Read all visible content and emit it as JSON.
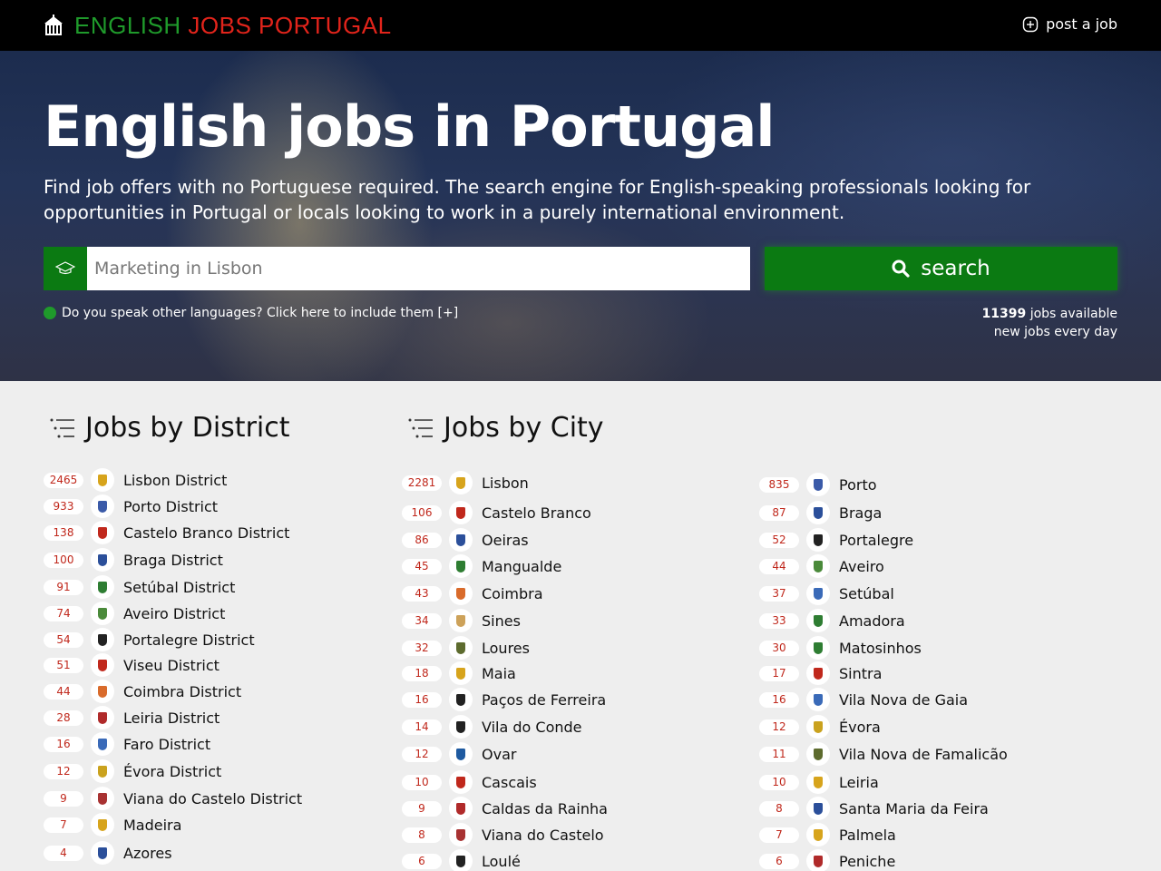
{
  "brand": {
    "part1": "ENGLISH",
    "part2": "JOBS PORTUGAL"
  },
  "nav": {
    "post_job": "post a job"
  },
  "hero": {
    "title": "English jobs in Portugal",
    "subtitle": "Find job offers with no Portuguese required. The search engine for English-speaking professionals looking for opportunities in Portugal or locals looking to work in a purely international environment."
  },
  "search": {
    "placeholder": "Marketing in Lisbon",
    "value": "",
    "button": "search"
  },
  "languages_link": "Do you speak other languages? Click here to include them [+]",
  "stats": {
    "count": "11399",
    "available": " jobs available",
    "new_jobs": "new jobs every day"
  },
  "districts": {
    "heading": "Jobs by District",
    "items": [
      {
        "count": "2465",
        "name": "Lisbon District",
        "color": "#d7a41c"
      },
      {
        "count": "933",
        "name": "Porto District",
        "color": "#3a5aa8"
      },
      {
        "count": "138",
        "name": "Castelo Branco District",
        "color": "#c0281c"
      },
      {
        "count": "100",
        "name": "Braga District",
        "color": "#2b4f9a"
      },
      {
        "count": "91",
        "name": "Setúbal District",
        "color": "#2e7d32"
      },
      {
        "count": "74",
        "name": "Aveiro District",
        "color": "#4a8a3a"
      },
      {
        "count": "54",
        "name": "Portalegre District",
        "color": "#222222"
      },
      {
        "count": "51",
        "name": "Viseu District",
        "color": "#c0281c"
      },
      {
        "count": "44",
        "name": "Coimbra District",
        "color": "#d96b2b"
      },
      {
        "count": "28",
        "name": "Leiria District",
        "color": "#b02a2a"
      },
      {
        "count": "16",
        "name": "Faro District",
        "color": "#3a6ab8"
      },
      {
        "count": "12",
        "name": "Évora District",
        "color": "#caa21e"
      },
      {
        "count": "9",
        "name": "Viana do Castelo District",
        "color": "#a83232"
      },
      {
        "count": "7",
        "name": "Madeira",
        "color": "#d7a41c"
      },
      {
        "count": "4",
        "name": "Azores",
        "color": "#2b4f9a"
      }
    ]
  },
  "cities": {
    "heading": "Jobs by City",
    "col1": [
      {
        "count": "2281",
        "name": "Lisbon",
        "color": "#d7a41c"
      },
      {
        "count": "106",
        "name": "Castelo Branco",
        "color": "#c0281c"
      },
      {
        "count": "86",
        "name": "Oeiras",
        "color": "#2b4f9a"
      },
      {
        "count": "45",
        "name": "Mangualde",
        "color": "#2e7d32"
      },
      {
        "count": "43",
        "name": "Coimbra",
        "color": "#d96b2b"
      },
      {
        "count": "34",
        "name": "Sines",
        "color": "#cda25a"
      },
      {
        "count": "32",
        "name": "Loures",
        "color": "#5d6b2e"
      },
      {
        "count": "18",
        "name": "Maia",
        "color": "#d7a41c"
      },
      {
        "count": "16",
        "name": "Paços de Ferreira",
        "color": "#222222"
      },
      {
        "count": "14",
        "name": "Vila do Conde",
        "color": "#222222"
      },
      {
        "count": "12",
        "name": "Ovar",
        "color": "#1e5aa0"
      },
      {
        "count": "10",
        "name": "Cascais",
        "color": "#c0281c"
      },
      {
        "count": "9",
        "name": "Caldas da Rainha",
        "color": "#b02a2a"
      },
      {
        "count": "8",
        "name": "Viana do Castelo",
        "color": "#a83232"
      },
      {
        "count": "6",
        "name": "Loulé",
        "color": "#222222"
      }
    ],
    "col2": [
      {
        "count": "835",
        "name": "Porto",
        "color": "#3a5aa8"
      },
      {
        "count": "87",
        "name": "Braga",
        "color": "#2b4f9a"
      },
      {
        "count": "52",
        "name": "Portalegre",
        "color": "#222222"
      },
      {
        "count": "44",
        "name": "Aveiro",
        "color": "#4a8a3a"
      },
      {
        "count": "37",
        "name": "Setúbal",
        "color": "#3a6ab8"
      },
      {
        "count": "33",
        "name": "Amadora",
        "color": "#2e7d32"
      },
      {
        "count": "30",
        "name": "Matosinhos",
        "color": "#2e7d32"
      },
      {
        "count": "17",
        "name": "Sintra",
        "color": "#c0281c"
      },
      {
        "count": "16",
        "name": "Vila Nova de Gaia",
        "color": "#3a6ab8"
      },
      {
        "count": "12",
        "name": "Évora",
        "color": "#caa21e"
      },
      {
        "count": "11",
        "name": "Vila Nova de Famalicão",
        "color": "#5d6b2e"
      },
      {
        "count": "10",
        "name": "Leiria",
        "color": "#d7a41c"
      },
      {
        "count": "8",
        "name": "Santa Maria da Feira",
        "color": "#2b4f9a"
      },
      {
        "count": "7",
        "name": "Palmela",
        "color": "#d7a41c"
      },
      {
        "count": "6",
        "name": "Peniche",
        "color": "#b02a2a"
      }
    ]
  }
}
